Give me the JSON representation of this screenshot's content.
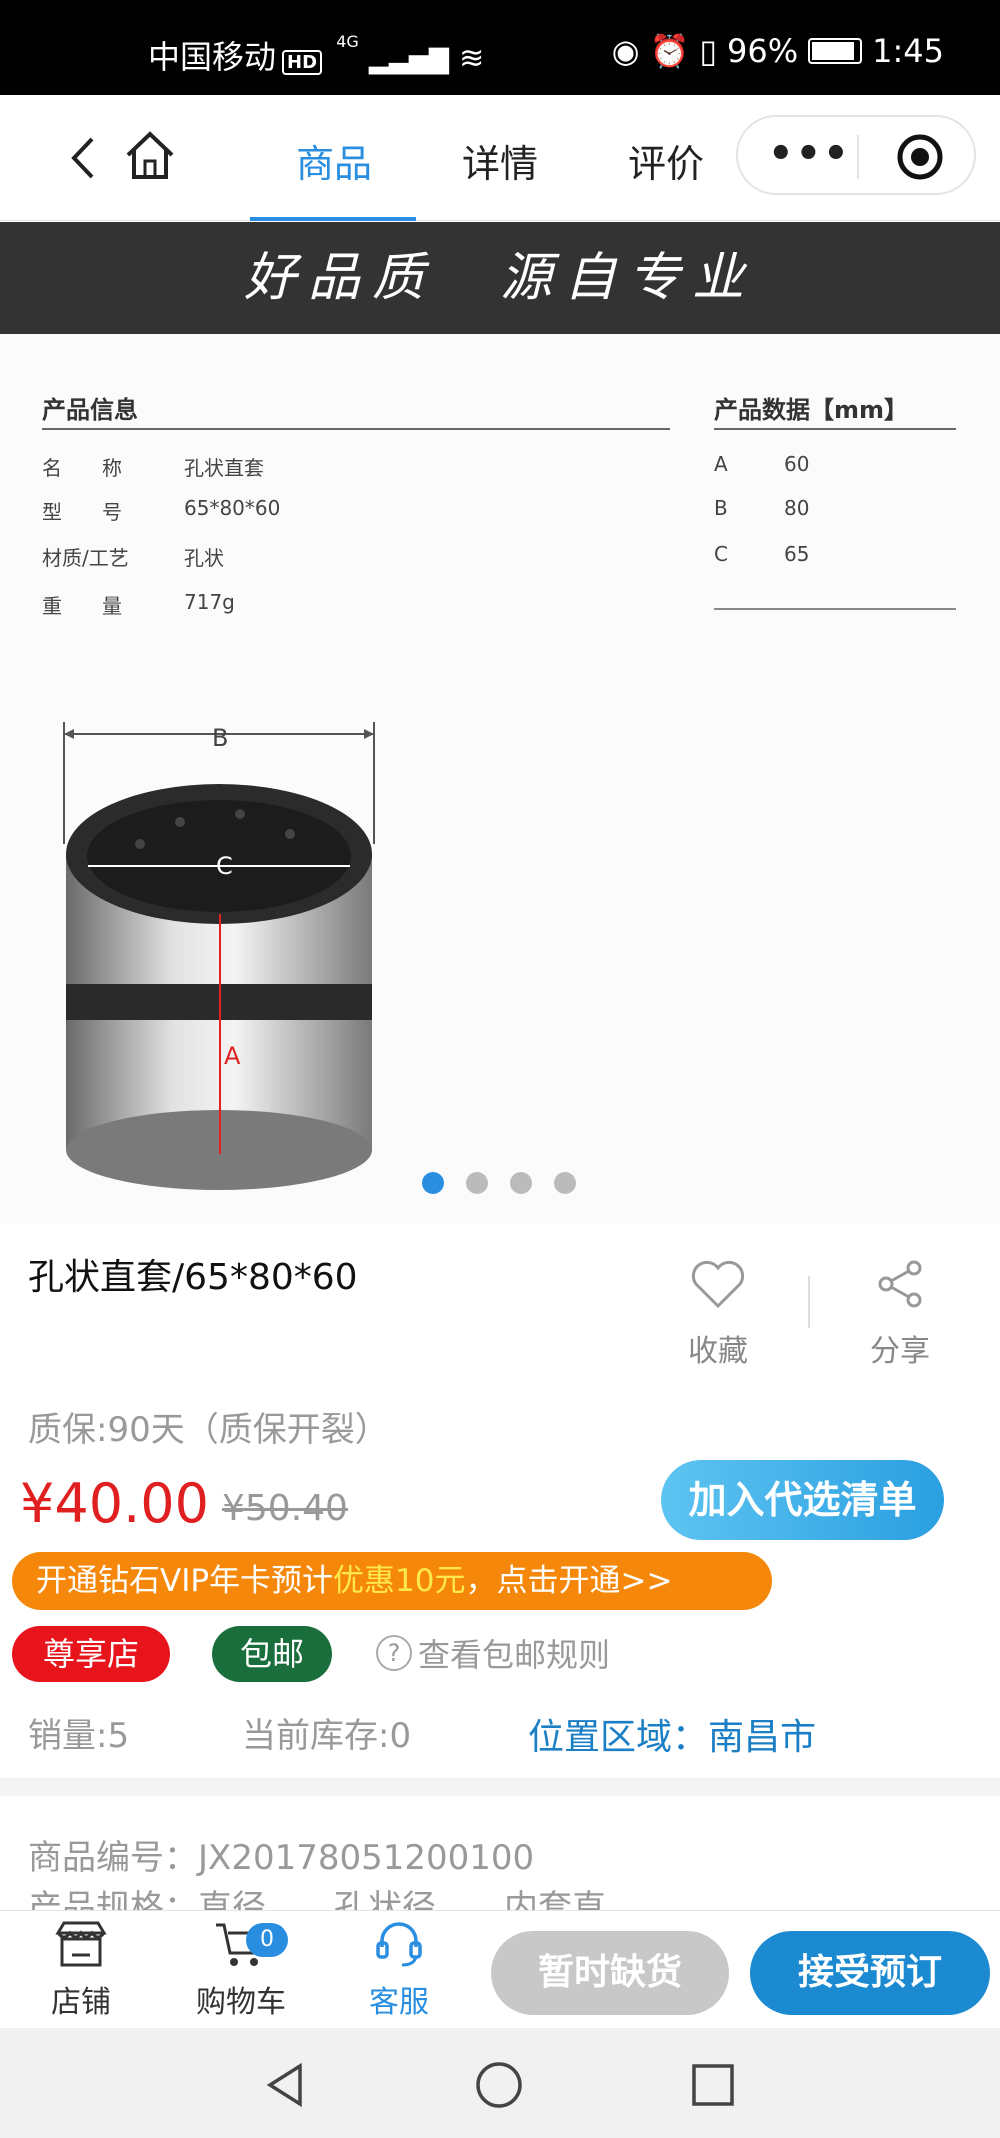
{
  "status_bar": {
    "carrier": "中国移动",
    "hd": "HD",
    "network": "4G",
    "battery": "96%",
    "time": "1:45"
  },
  "nav": {
    "tabs": [
      "商品",
      "详情",
      "评价"
    ],
    "active_tab": "商品"
  },
  "banner": {
    "text": "好品质　源自专业"
  },
  "specs": {
    "info_title": "产品信息",
    "info_rows": [
      {
        "label": "名　　称",
        "value": "孔状直套"
      },
      {
        "label": "型　　号",
        "value": "65*80*60"
      },
      {
        "label": "材质/工艺",
        "value": "孔状"
      },
      {
        "label": "重　　量",
        "value": "717g"
      }
    ],
    "data_title": "产品数据【mm】",
    "data_rows": [
      {
        "label": "A",
        "value": "60"
      },
      {
        "label": "B",
        "value": "80"
      },
      {
        "label": "C",
        "value": "65"
      }
    ],
    "diagram_labels": {
      "b": "B",
      "c": "C",
      "a": "A"
    }
  },
  "carousel": {
    "total": 4,
    "active": 1
  },
  "product": {
    "title": "孔状直套/65*80*60",
    "favorite_label": "收藏",
    "share_label": "分享",
    "warranty": "质保:90天（质保开裂）",
    "price": "¥40.00",
    "original_price": "¥50.40",
    "add_button": "加入代选清单"
  },
  "vip": {
    "prefix": "开通钻石VIP年卡预计",
    "highlight": "优惠10元",
    "suffix": "，点击开通>>"
  },
  "tags": {
    "premium_store": "尊享店",
    "free_shipping": "包邮",
    "shipping_rule": "查看包邮规则"
  },
  "stats": {
    "sales": "销量:5",
    "stock": "当前库存:0",
    "location": "位置区域：南昌市"
  },
  "details": {
    "product_code": "商品编号：JX20178051200100",
    "partial_row": "产品规格：直径　　孔状径　　内套直"
  },
  "bottom_bar": {
    "store": "店铺",
    "cart": "购物车",
    "cart_count": "0",
    "service": "客服",
    "out_of_stock": "暂时缺货",
    "preorder": "接受预订"
  },
  "colors": {
    "accent": "#2a8ee0",
    "price": "#e02020",
    "vip": "#f5880a",
    "premium_tag": "#e8141c",
    "shipping_tag": "#1a6e3c"
  }
}
